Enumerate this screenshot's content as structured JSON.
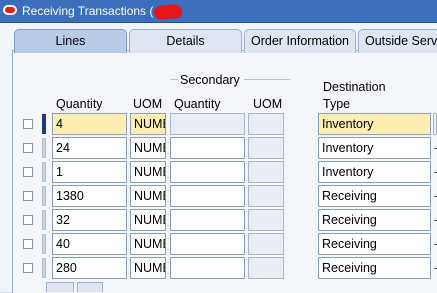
{
  "window": {
    "title": "Receiving Transactions ("
  },
  "tabs": [
    {
      "label": "Lines",
      "active": true
    },
    {
      "label": "Details",
      "active": false
    },
    {
      "label": "Order Information",
      "active": false
    },
    {
      "label": "Outside Serv",
      "active": false
    }
  ],
  "headers": {
    "quantity": "Quantity",
    "uom": "UOM",
    "secondary": "Secondary",
    "secondary_quantity": "Quantity",
    "secondary_uom": "UOM",
    "destination_type_line1": "Destination",
    "destination_type_line2": "Type"
  },
  "rows": [
    {
      "quantity": "4",
      "uom": "NUMBER",
      "destination_type": "Inventory"
    },
    {
      "quantity": "24",
      "uom": "NUMBER",
      "destination_type": "Inventory"
    },
    {
      "quantity": "1",
      "uom": "NUMBER",
      "destination_type": "Inventory"
    },
    {
      "quantity": "1380",
      "uom": "NUMBER",
      "destination_type": "Receiving"
    },
    {
      "quantity": "32",
      "uom": "NUMBER",
      "destination_type": "Receiving"
    },
    {
      "quantity": "40",
      "uom": "NUMBER",
      "destination_type": "Receiving"
    },
    {
      "quantity": "280",
      "uom": "NUMBER",
      "destination_type": "Receiving"
    }
  ],
  "colors": {
    "titlebar": "#3b6fbb",
    "highlight_row": "#fcedb0",
    "current_record_marker": "#1f3a78"
  }
}
